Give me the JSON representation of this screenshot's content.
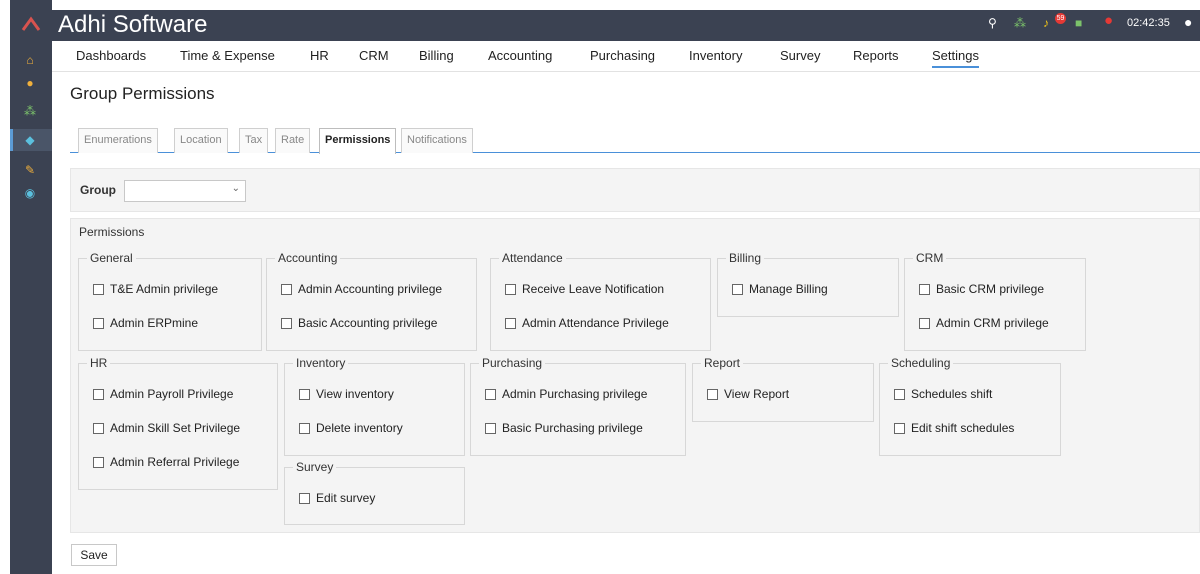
{
  "app": {
    "title": "Adhi Software",
    "clock": "02:42:35",
    "notification_count": "59"
  },
  "sidebar": {
    "items": [
      {
        "icon": "home-icon"
      },
      {
        "icon": "user-icon"
      },
      {
        "icon": "share-icon"
      },
      {
        "icon": "tag-icon"
      },
      {
        "icon": "wrench-icon"
      },
      {
        "icon": "globe-icon"
      }
    ]
  },
  "menu": {
    "items": [
      {
        "label": "Dashboards"
      },
      {
        "label": "Time & Expense"
      },
      {
        "label": "HR"
      },
      {
        "label": "CRM"
      },
      {
        "label": "Billing"
      },
      {
        "label": "Accounting"
      },
      {
        "label": "Purchasing"
      },
      {
        "label": "Inventory"
      },
      {
        "label": "Survey"
      },
      {
        "label": "Reports"
      },
      {
        "label": "Settings"
      }
    ],
    "active": "Settings"
  },
  "page": {
    "title": "Group Permissions"
  },
  "tabs": [
    {
      "label": "Enumerations"
    },
    {
      "label": "Location"
    },
    {
      "label": "Tax"
    },
    {
      "label": "Rate"
    },
    {
      "label": "Permissions"
    },
    {
      "label": "Notifications"
    }
  ],
  "group": {
    "label": "Group",
    "value": ""
  },
  "permissions": {
    "legend": "Permissions",
    "groups": {
      "general": {
        "title": "General",
        "items": [
          "T&E Admin privilege",
          "Admin ERPmine"
        ]
      },
      "accounting": {
        "title": "Accounting",
        "items": [
          "Admin Accounting privilege",
          "Basic Accounting privilege"
        ]
      },
      "attendance": {
        "title": "Attendance",
        "items": [
          "Receive Leave Notification",
          "Admin Attendance Privilege"
        ]
      },
      "billing": {
        "title": "Billing",
        "items": [
          "Manage Billing"
        ]
      },
      "crm": {
        "title": "CRM",
        "items": [
          "Basic CRM privilege",
          "Admin CRM privilege"
        ]
      },
      "hr": {
        "title": "HR",
        "items": [
          "Admin Payroll Privilege",
          "Admin Skill Set Privilege",
          "Admin Referral Privilege"
        ]
      },
      "inventory": {
        "title": "Inventory",
        "items": [
          "View inventory",
          "Delete inventory"
        ]
      },
      "purchasing": {
        "title": "Purchasing",
        "items": [
          "Admin Purchasing privilege",
          "Basic Purchasing privilege"
        ]
      },
      "report": {
        "title": "Report",
        "items": [
          "View Report"
        ]
      },
      "scheduling": {
        "title": "Scheduling",
        "items": [
          "Schedules shift",
          "Edit shift schedules"
        ]
      },
      "survey": {
        "title": "Survey",
        "items": [
          "Edit survey"
        ]
      }
    }
  },
  "actions": {
    "save_label": "Save"
  }
}
